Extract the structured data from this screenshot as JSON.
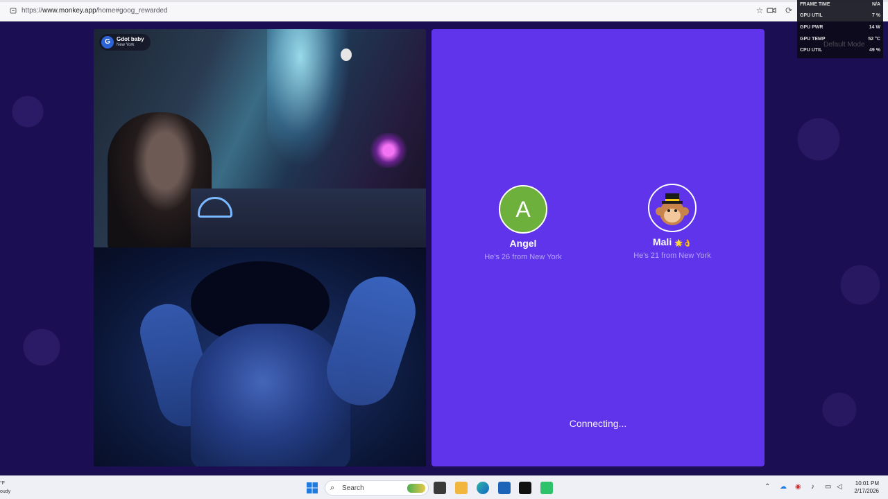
{
  "browser": {
    "url_prefix": "https://",
    "url_host": "www.monkey.app",
    "url_rest": "/home#goog_rewarded"
  },
  "badge": {
    "initial": "G",
    "name": "Gdot baby",
    "location": "New York"
  },
  "panel": {
    "users": [
      {
        "initial": "A",
        "name": "Angel",
        "subtitle": "He's 26 from New York"
      },
      {
        "name": "Mali",
        "name_suffix": "🌟👌",
        "subtitle": "He's 21 from New York"
      }
    ],
    "status": "Connecting..."
  },
  "perf_overlay": {
    "rows": [
      {
        "label": "FRAME TIME",
        "value": "N/A"
      },
      {
        "label": "GPU UTIL",
        "value": "7 %"
      },
      {
        "label": "GPU PWR",
        "value": "14 W"
      },
      {
        "label": "GPU TEMP",
        "value": "52 °C"
      },
      {
        "label": "CPU UTIL",
        "value": "49 %"
      }
    ],
    "mode": "Default Mode"
  },
  "taskbar": {
    "weather_temp": "°F",
    "weather_desc": "oudy",
    "search_label": "Search",
    "time": "10:01 PM",
    "date": "2/17/2026"
  },
  "colors": {
    "page_bg": "#1c0e52",
    "panel_bg": "#6034ea",
    "avatar_green": "#6db13c",
    "subtitle": "#b8a6ff"
  }
}
